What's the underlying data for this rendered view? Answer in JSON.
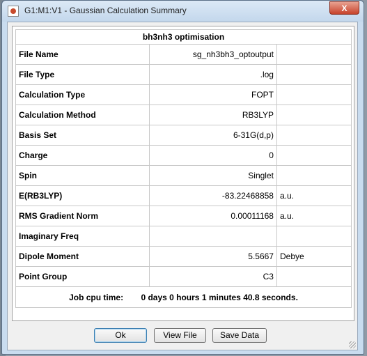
{
  "window": {
    "title": "G1:M1:V1 - Gaussian Calculation Summary",
    "close_label": "X"
  },
  "summary": {
    "heading": "bh3nh3 optimisation",
    "rows": [
      {
        "label": "File Name",
        "value": "sg_nh3bh3_optoutput",
        "unit": ""
      },
      {
        "label": "File Type",
        "value": ".log",
        "unit": ""
      },
      {
        "label": "Calculation Type",
        "value": "FOPT",
        "unit": ""
      },
      {
        "label": "Calculation Method",
        "value": "RB3LYP",
        "unit": ""
      },
      {
        "label": "Basis Set",
        "value": "6-31G(d,p)",
        "unit": ""
      },
      {
        "label": "Charge",
        "value": "0",
        "unit": ""
      },
      {
        "label": "Spin",
        "value": "Singlet",
        "unit": ""
      },
      {
        "label": "E(RB3LYP)",
        "value": "-83.22468858",
        "unit": "a.u."
      },
      {
        "label": "RMS Gradient Norm",
        "value": "0.00011168",
        "unit": "a.u."
      },
      {
        "label": "Imaginary Freq",
        "value": "",
        "unit": ""
      },
      {
        "label": "Dipole Moment",
        "value": "5.5667",
        "unit": "Debye"
      },
      {
        "label": "Point Group",
        "value": "C3",
        "unit": ""
      }
    ],
    "job_time": {
      "label": "Job cpu time:",
      "days": "0 days",
      "hours": "0 hours",
      "minutes": "1 minutes",
      "seconds": "40.8 seconds."
    }
  },
  "buttons": {
    "ok": "Ok",
    "view_file": "View File",
    "save_data": "Save Data"
  }
}
